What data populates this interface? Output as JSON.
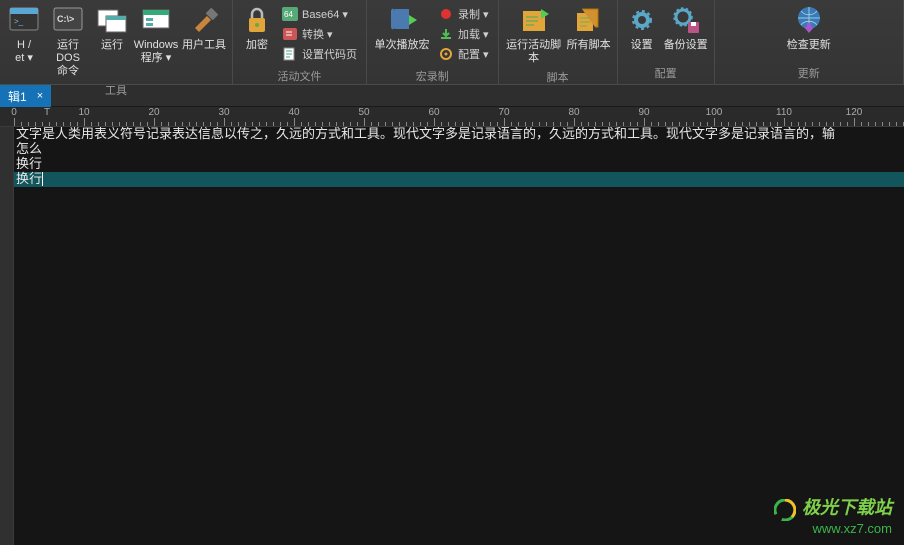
{
  "ribbon": {
    "groups": {
      "tools": {
        "label": "工具",
        "ssh": "H /\net ▾",
        "dos": "运行 DOS\n命令",
        "run": "运行",
        "windows": "Windows\n程序 ▾",
        "usertools": "用户工具"
      },
      "activefile": {
        "label": "活动文件",
        "encrypt": "加密",
        "base64": "Base64 ▾",
        "convert": "转换 ▾",
        "codepage": "设置代码页"
      },
      "macro": {
        "label": "宏录制",
        "playonce": "单次播放宏",
        "record": "录制 ▾",
        "load": "加载 ▾",
        "config": "配置 ▾"
      },
      "script": {
        "label": "脚本",
        "runactive": "运行活动脚本",
        "all": "所有脚本"
      },
      "config": {
        "label": "配置",
        "settings": "设置",
        "backup": "备份设置"
      },
      "update": {
        "label": "更新",
        "check": "检查更新"
      }
    }
  },
  "tabbar": {
    "tab1": {
      "label": "辑1",
      "close": "×"
    }
  },
  "ruler": {
    "ticks": [
      0,
      10,
      20,
      30,
      40,
      50,
      60,
      70,
      80,
      90,
      100,
      110,
      120
    ]
  },
  "editor": {
    "lines": [
      "  文字是人类用表义符号记录表达信息以传之，久远的方式和工具。现代文字多是记录语言的，久远的方式和工具。现代文字多是记录语言的，输",
      "怎么",
      "换行",
      "换行"
    ],
    "currentLine": 3
  },
  "watermark": {
    "brand": "极光下载站",
    "url": "www.xz7.com"
  }
}
